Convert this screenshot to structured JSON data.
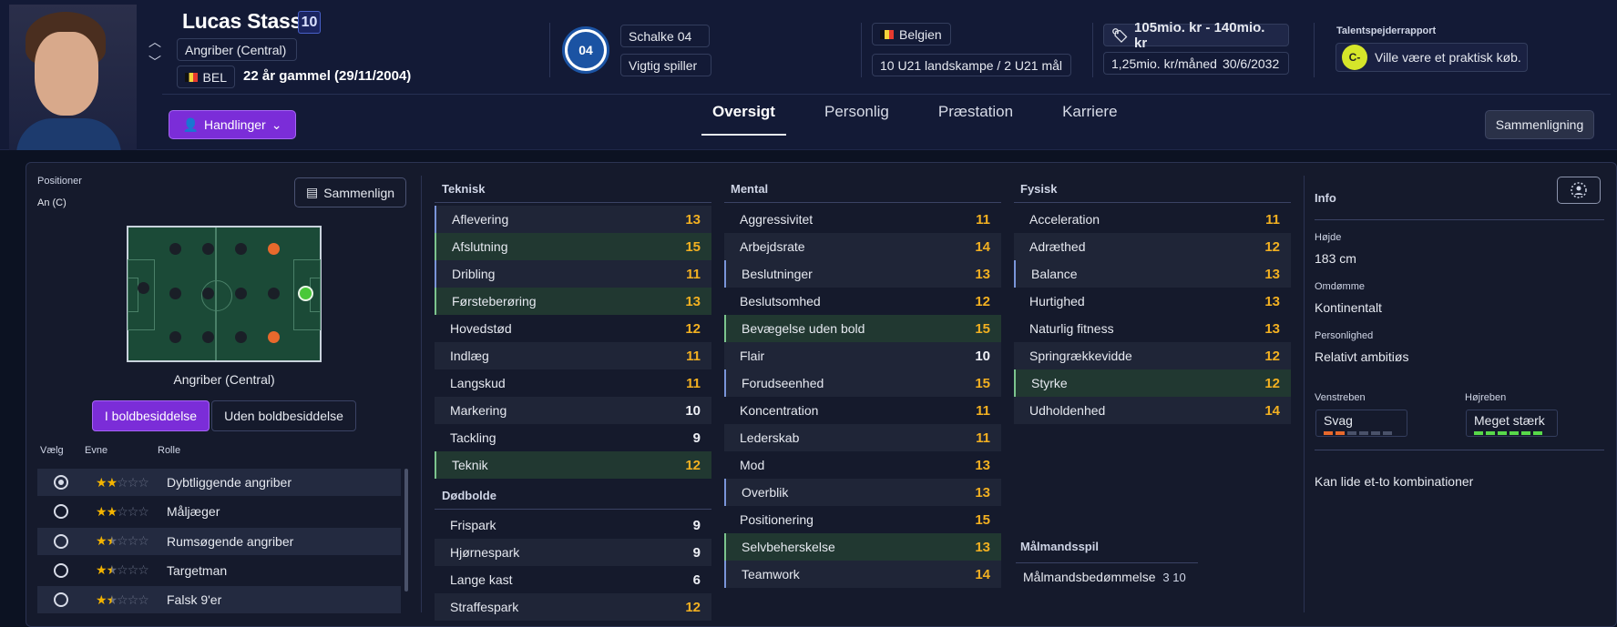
{
  "player": {
    "name": "Lucas Stassin",
    "shirt_number": "10",
    "position": "Angriber (Central)",
    "nationality_code": "BEL",
    "age_text": "22 år gammel (29/11/2004)"
  },
  "club": {
    "logo_text": "04",
    "name": "Schalke 04",
    "status": "Vigtig spiller"
  },
  "nation": {
    "name": "Belgien",
    "caps": "10 U21 landskampe / 2 U21 mål"
  },
  "contract": {
    "value": "105mio. kr - 140mio. kr",
    "wage": "1,25mio. kr/måned",
    "expires": "30/6/2032"
  },
  "scout": {
    "label": "Talentspejderrapport",
    "grade": "C-",
    "text": "Ville være et praktisk køb."
  },
  "actions_label": "Handlinger",
  "tabs": [
    "Oversigt",
    "Personlig",
    "Præstation",
    "Karriere"
  ],
  "compare_top": "Sammenligning",
  "positions": {
    "label": "Positioner",
    "value": "An (C)",
    "compare_label": "Sammenlign",
    "pitch_position": "Angriber (Central)"
  },
  "possession": {
    "with": "I boldbesiddelse",
    "without": "Uden boldbesiddelse"
  },
  "roles_header": {
    "select": "Vælg",
    "ability": "Evne",
    "role": "Rolle"
  },
  "roles": [
    {
      "name": "Dybtliggende angriber",
      "stars": 2,
      "selected": true
    },
    {
      "name": "Måljæger",
      "stars": 2,
      "selected": false
    },
    {
      "name": "Rumsøgende angriber",
      "stars": 1.5,
      "selected": false
    },
    {
      "name": "Targetman",
      "stars": 1.5,
      "selected": false
    },
    {
      "name": "Falsk 9'er",
      "stars": 1.5,
      "selected": false
    }
  ],
  "technical": {
    "title": "Teknisk",
    "attrs": [
      {
        "name": "Aflevering",
        "value": "13"
      },
      {
        "name": "Afslutning",
        "value": "15"
      },
      {
        "name": "Dribling",
        "value": "11"
      },
      {
        "name": "Førsteberøring",
        "value": "13"
      },
      {
        "name": "Hovedstød",
        "value": "12"
      },
      {
        "name": "Indlæg",
        "value": "11"
      },
      {
        "name": "Langskud",
        "value": "11"
      },
      {
        "name": "Markering",
        "value": "10"
      },
      {
        "name": "Tackling",
        "value": "9"
      },
      {
        "name": "Teknik",
        "value": "12"
      }
    ]
  },
  "setpieces": {
    "title": "Dødbolde",
    "attrs": [
      {
        "name": "Frispark",
        "value": "9"
      },
      {
        "name": "Hjørnespark",
        "value": "9"
      },
      {
        "name": "Lange kast",
        "value": "6"
      },
      {
        "name": "Straffespark",
        "value": "12"
      }
    ]
  },
  "mental": {
    "title": "Mental",
    "attrs": [
      {
        "name": "Aggressivitet",
        "value": "11"
      },
      {
        "name": "Arbejdsrate",
        "value": "14"
      },
      {
        "name": "Beslutninger",
        "value": "13"
      },
      {
        "name": "Beslutsomhed",
        "value": "12"
      },
      {
        "name": "Bevægelse uden bold",
        "value": "15"
      },
      {
        "name": "Flair",
        "value": "10"
      },
      {
        "name": "Forudseenhed",
        "value": "15"
      },
      {
        "name": "Koncentration",
        "value": "11"
      },
      {
        "name": "Lederskab",
        "value": "11"
      },
      {
        "name": "Mod",
        "value": "13"
      },
      {
        "name": "Overblik",
        "value": "13"
      },
      {
        "name": "Positionering",
        "value": "15"
      },
      {
        "name": "Selvbeherskelse",
        "value": "13"
      },
      {
        "name": "Teamwork",
        "value": "14"
      }
    ]
  },
  "physical": {
    "title": "Fysisk",
    "attrs": [
      {
        "name": "Acceleration",
        "value": "11"
      },
      {
        "name": "Adræthed",
        "value": "12"
      },
      {
        "name": "Balance",
        "value": "13"
      },
      {
        "name": "Hurtighed",
        "value": "13"
      },
      {
        "name": "Naturlig fitness",
        "value": "13"
      },
      {
        "name": "Springrækkevidde",
        "value": "12"
      },
      {
        "name": "Styrke",
        "value": "12"
      },
      {
        "name": "Udholdenhed",
        "value": "14"
      }
    ]
  },
  "goalkeeping": {
    "title": "Målmandsspil",
    "row_label": "Målmandsbedømmelse",
    "row_value": "3 10"
  },
  "info": {
    "title": "Info",
    "height_label": "Højde",
    "height": "183 cm",
    "reputation_label": "Omdømme",
    "reputation": "Kontinentalt",
    "personality_label": "Personlighed",
    "personality": "Relativt ambitiøs",
    "left_foot_label": "Venstreben",
    "left_foot": "Svag",
    "right_foot_label": "Højreben",
    "right_foot": "Meget stærk",
    "trait": "Kan lide et-to kombinationer"
  },
  "colors": {
    "accent": "#7b2dd8",
    "value_high": "#f2b021",
    "foot_weak": "#e8692c",
    "foot_strong": "#58d94a"
  }
}
